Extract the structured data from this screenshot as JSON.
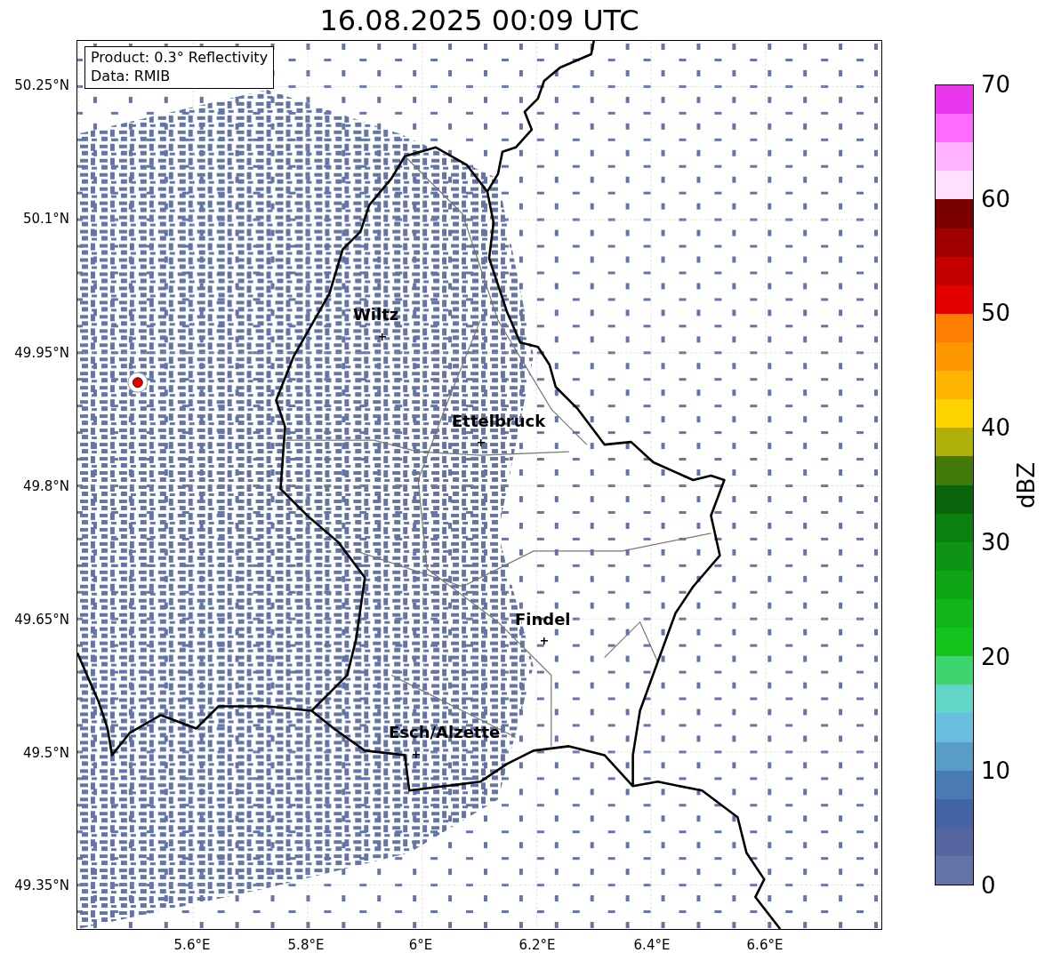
{
  "title": "16.08.2025 00:09 UTC",
  "info_box": [
    "Product: 0.3° Reflectivity",
    "Data: RMIB"
  ],
  "map": {
    "cities": [
      {
        "name": "Wiltz"
      },
      {
        "name": "Ettelbruck"
      },
      {
        "name": "Findel"
      },
      {
        "name": "Esch/Alzette"
      }
    ]
  },
  "x_axis": {
    "ticks": [
      "5.6°E",
      "5.8°E",
      "6°E",
      "6.2°E",
      "6.4°E",
      "6.6°E"
    ]
  },
  "y_axis": {
    "ticks": [
      "50.25°N",
      "50.1°N",
      "49.95°N",
      "49.8°N",
      "49.65°N",
      "49.5°N",
      "49.35°N"
    ]
  },
  "colorbar": {
    "label": "dBZ",
    "ticks": [
      "70",
      "60",
      "50",
      "40",
      "30",
      "20",
      "10",
      "0"
    ],
    "bins": [
      {
        "color": "#e836ec"
      },
      {
        "color": "#ff6aff"
      },
      {
        "color": "#ffb2ff"
      },
      {
        "color": "#ffe0ff"
      },
      {
        "color": "#7a0000"
      },
      {
        "color": "#a00000"
      },
      {
        "color": "#c40000"
      },
      {
        "color": "#e20000"
      },
      {
        "color": "#fd7e00"
      },
      {
        "color": "#fd9800"
      },
      {
        "color": "#fdb400"
      },
      {
        "color": "#fdd400"
      },
      {
        "color": "#afb00a"
      },
      {
        "color": "#437a0a"
      },
      {
        "color": "#08650c"
      },
      {
        "color": "#0b7f10"
      },
      {
        "color": "#0e9314"
      },
      {
        "color": "#10a515"
      },
      {
        "color": "#12b51a"
      },
      {
        "color": "#14c41c"
      },
      {
        "color": "#3ed56e"
      },
      {
        "color": "#62d6c6"
      },
      {
        "color": "#68bedc"
      },
      {
        "color": "#5a9cc8"
      },
      {
        "color": "#4a7ab2"
      },
      {
        "color": "#4463a3"
      },
      {
        "color": "#5465a0"
      },
      {
        "color": "#6374a6"
      }
    ]
  }
}
